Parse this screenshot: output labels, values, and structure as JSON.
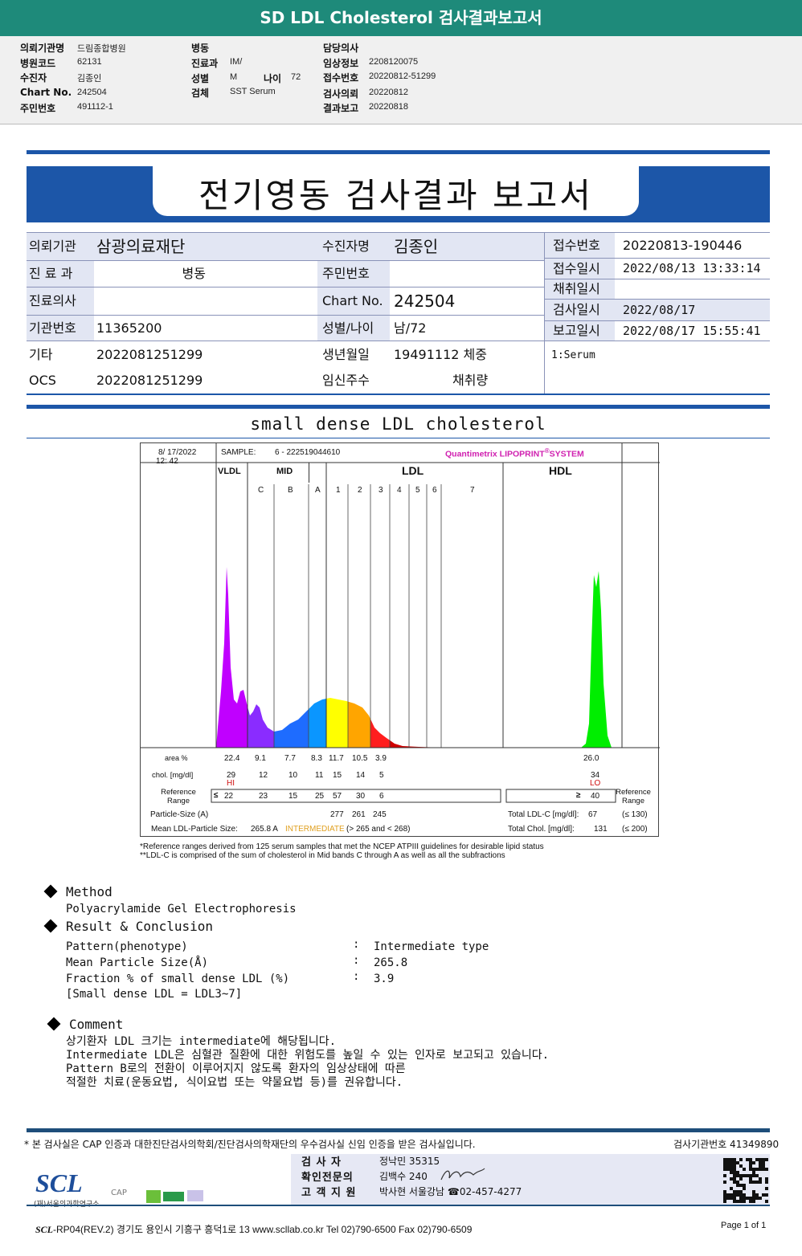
{
  "header": {
    "title": "SD LDL Cholesterol 검사결과보고서"
  },
  "info": {
    "col1": [
      {
        "label": "의뢰기관명",
        "value": "드림종합병원"
      },
      {
        "label": "병원코드",
        "value": "62131"
      },
      {
        "label": "수진자",
        "value": "김종인"
      },
      {
        "label": "Chart No.",
        "value": "242504"
      },
      {
        "label": "주민번호",
        "value": "491112-1"
      }
    ],
    "col2": [
      {
        "label": "병동",
        "value": ""
      },
      {
        "label": "진료과",
        "value": "IM/"
      },
      {
        "label": "성별",
        "value": "M"
      },
      {
        "label": "검체",
        "value": "SST Serum"
      }
    ],
    "age": {
      "label": "나이",
      "value": "72"
    },
    "col3": [
      {
        "label": "담당의사",
        "value": ""
      },
      {
        "label": "임상정보",
        "value": "2208120075"
      },
      {
        "label": "접수번호",
        "value": "20220812-51299"
      },
      {
        "label": "검사의뢰",
        "value": "20220812"
      },
      {
        "label": "결과보고",
        "value": "20220818"
      }
    ]
  },
  "report": {
    "title": "전기영동 검사결과 보고서",
    "left": [
      {
        "l1": "의뢰기관",
        "v1": "삼광의료재단",
        "l2": "수진자명",
        "v2": "김종인"
      },
      {
        "l1": "진 료 과",
        "v1": "병동",
        "l2": "주민번호",
        "v2": ""
      },
      {
        "l1": "진료의사",
        "v1": "",
        "l2": "Chart No.",
        "v2": "242504"
      },
      {
        "l1": "기관번호",
        "v1": "11365200",
        "l2": "성별/나이",
        "v2": "남/72"
      },
      {
        "l1": "기타",
        "v1": "2022081251299",
        "l2": "생년월일",
        "v2": "19491112 체중"
      },
      {
        "l1": "OCS",
        "v1": "2022081251299",
        "l2": "임신주수",
        "v2": "채취량"
      }
    ],
    "right": [
      {
        "label": "접수번호",
        "value": "20220813-190446"
      },
      {
        "label": "접수일시",
        "value": "2022/08/13 13:33:14"
      },
      {
        "label": "채취일시",
        "value": ""
      },
      {
        "label": "검사일시",
        "value": "2022/08/17"
      },
      {
        "label": "보고일시",
        "value": "2022/08/17 15:55:41"
      }
    ],
    "specimen": "1:Serum"
  },
  "section_title": "small dense LDL cholesterol",
  "chart": {
    "date": "8/ 17/2022",
    "time": "12: 42",
    "sample_label": "SAMPLE:",
    "sample": "6 - 222519044610",
    "brand": "Quantimetrix LIPOPRINT",
    "brand_mark": "®",
    "brand_suffix": "SYSTEM",
    "groups": [
      "VLDL",
      "MID",
      "LDL",
      "HDL"
    ],
    "bands": [
      "C",
      "B",
      "A",
      "1",
      "2",
      "3",
      "4",
      "5",
      "6",
      "7"
    ],
    "colors": {
      "VLDL": "#c000ff",
      "C": "#8a2cff",
      "B": "#1e6cff",
      "A": "#0a96ff",
      "1": "#ffff00",
      "2": "#ffa500",
      "3": "#ff1e1e",
      "4": "#d00000",
      "HDL": "#00ee00"
    },
    "rows": {
      "area_label": "area %",
      "area": [
        "22.4",
        "9.1",
        "7.7",
        "8.3",
        "11.7",
        "10.5",
        "3.9"
      ],
      "area_hdl": "26.0",
      "chol_label": "chol. [mg/dl]",
      "chol": [
        "29",
        "12",
        "10",
        "11",
        "15",
        "14",
        "5"
      ],
      "chol_hdl": "34",
      "flag_vldl": "HI",
      "flag_hdl": "LO",
      "ref_label": "Reference Range",
      "ref_sym": "≤",
      "ref": [
        "22",
        "23",
        "15",
        "25",
        "57",
        "30",
        "6"
      ],
      "ref_hdl_sym": "≥",
      "ref_hdl": "40",
      "size_label": "Particle-Size (A)",
      "size": [
        "277",
        "261",
        "245"
      ],
      "mean_label": "Mean LDL-Particle Size:",
      "mean_value": "265.8 A",
      "mean_class": "INTERMEDIATE",
      "mean_range": "(> 265 and < 268)",
      "total_ldl_label": "Total LDL-C [mg/dl]:",
      "total_ldl": "67",
      "total_ldl_ref": "(≤ 130)",
      "total_chol_label": "Total Chol. [mg/dl]:",
      "total_chol": "131",
      "total_chol_ref": "(≤ 200)"
    },
    "notes": [
      "*Reference ranges derived from 125 serum samples that met the NCEP ATPIII guidelines for desirable lipid status",
      "**LDL-C is comprised of the sum of cholesterol in Mid bands C through A as well as all the subfractions"
    ]
  },
  "method": {
    "title": "Method",
    "text": "Polyacrylamide Gel Electrophoresis"
  },
  "result": {
    "title": "Result & Conclusion",
    "items": [
      {
        "label": "Pattern(phenotype)",
        "value": "Intermediate type"
      },
      {
        "label": "Mean Particle Size(Å)",
        "value": "265.8"
      },
      {
        "label": "Fraction % of small dense LDL (%)",
        "value": "3.9"
      }
    ],
    "note": "[Small dense LDL = LDL3~7]"
  },
  "comment": {
    "title": "Comment",
    "lines": [
      "상기환자 LDL 크기는 intermediate에 해당됩니다.",
      "Intermediate LDL은 심혈관 질환에 대한 위험도를 높일 수 있는 인자로 보고되고 있습니다.",
      "Pattern B로의 전환이 이루어지지 않도록 환자의 임상상태에 따른",
      "적절한 치료(운동요법, 식이요법 또는 약물요법 등)를 권유합니다."
    ]
  },
  "footer": {
    "cert": "* 본 검사실은 CAP 인증과 대한진단검사의학회/진단검사의학재단의 우수검사실 신임 인증을 받은 검사실입니다.",
    "lab_no": "검사기관번호 41349890",
    "staff": [
      {
        "label": "검 사 자",
        "value": "정낙민 35315"
      },
      {
        "label": "확인전문의",
        "value": "김백수 240"
      },
      {
        "label": "고 객 지 원",
        "value": "박사현 서울강남 ☎02-457-4277"
      }
    ],
    "logo": "SCL",
    "logo_sub": "(재)서울의과학연구소",
    "cap": "CAP",
    "address_brand": "SCL",
    "address": "-RP04(REV.2)  경기도 용인시 기흥구 흥덕1로 13  www.scllab.co.kr   Tel 02)790-6500   Fax 02)790-6509",
    "page": "Page 1 of 1"
  }
}
